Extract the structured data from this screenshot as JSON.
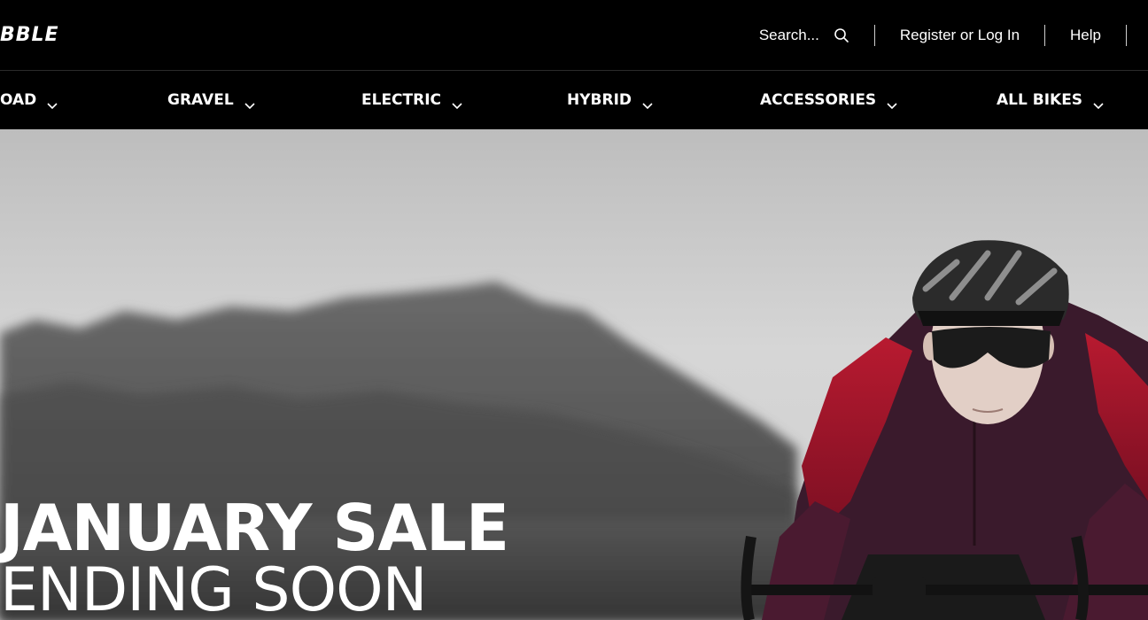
{
  "brand": {
    "logo_text": "BBLE"
  },
  "header": {
    "search_label": "Search...",
    "register_label": "Register or Log In",
    "help_label": "Help"
  },
  "nav": {
    "items": [
      {
        "label": "OAD"
      },
      {
        "label": "GRAVEL"
      },
      {
        "label": "ELECTRIC"
      },
      {
        "label": "HYBRID"
      },
      {
        "label": "ACCESSORIES"
      },
      {
        "label": "ALL BIKES"
      }
    ]
  },
  "hero": {
    "title": "JANUARY SALE",
    "subtitle": "ENDING SOON"
  },
  "colors": {
    "background": "#000000",
    "text": "#ffffff",
    "jersey_red": "#a0142a",
    "jersey_plum": "#3a1a2c"
  }
}
